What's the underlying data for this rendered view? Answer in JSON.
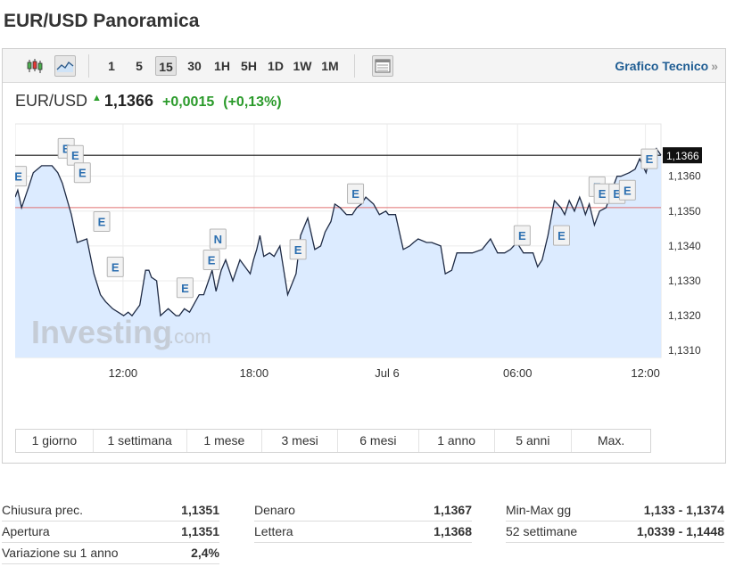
{
  "page": {
    "title": "EUR/USD Panoramica"
  },
  "toolbar": {
    "icons": [
      {
        "name": "candlestick-icon"
      },
      {
        "name": "line-chart-icon",
        "active": true
      }
    ],
    "timeframes": [
      {
        "label": "1"
      },
      {
        "label": "5"
      },
      {
        "label": "15",
        "active": true
      },
      {
        "label": "30"
      },
      {
        "label": "1H"
      },
      {
        "label": "5H"
      },
      {
        "label": "1D"
      },
      {
        "label": "1W"
      },
      {
        "label": "1M"
      }
    ],
    "technical_link": "Grafico Tecnico",
    "technical_chevron": "»"
  },
  "quote": {
    "symbol": "EUR/USD",
    "direction_icon": "▲",
    "last": "1,1366",
    "change": "+0,0015",
    "change_pct": "(+0,13%)",
    "up_color": "#2a9a2a"
  },
  "chart_data": {
    "type": "area",
    "y_ticks": [
      "1,1360",
      "1,1350",
      "1,1340",
      "1,1330",
      "1,1320",
      "1,1310"
    ],
    "ylim": [
      1.1308,
      1.1375
    ],
    "x_ticks": [
      "12:00",
      "18:00",
      "Jul 6",
      "06:00",
      "12:00"
    ],
    "last_price_label": "1,1366",
    "last_price": 1.1366,
    "prev_close": 1.1351,
    "grid": true,
    "line_color": "#1e2a44",
    "fill_color": "#dcebff",
    "prev_close_color": "#e07070",
    "watermark": "Investing",
    "watermark_suffix": ".com",
    "series": [
      {
        "x_index": [
          0,
          0.4,
          1,
          2.1,
          2.8,
          4.1,
          5.7,
          6.6,
          7.3,
          8.7,
          9.6,
          11.1,
          12.2,
          13.2,
          14,
          15.1,
          16.8,
          17.5,
          18.1,
          19.3,
          20.2,
          20.7,
          21.1,
          21.9,
          22.5,
          23.7,
          24.9,
          25.4,
          26.2,
          27,
          28.5,
          29.2,
          30.5,
          31.1,
          31.9,
          32.6,
          33.7,
          34.8,
          36.4,
          36.9,
          37.4,
          37.9,
          38.5,
          39.4,
          40.1,
          41,
          42.2,
          43.5,
          44.2,
          45.3,
          46.4,
          47.3,
          48,
          48.9,
          49.5,
          50.3,
          51.3,
          52.2,
          52.9,
          53.6,
          54.3,
          55.5,
          56.4,
          57.4,
          57.8,
          58.9,
          60.1,
          61.1,
          61.7,
          62.4,
          63.7,
          64.5,
          65.9,
          66.6,
          67.6,
          68.4,
          69.5,
          70.3,
          70.8,
          72.3,
          73.6,
          74.7,
          75.8,
          76.7,
          77.7,
          78.7,
          79.5,
          80.2,
          80.9,
          81.6,
          82.5,
          83.5,
          84.5,
          85.1,
          85.8,
          86.6,
          87.4,
          87.8,
          88.3,
          88.9,
          89.7,
          90.5,
          91.5,
          92.6,
          93.2,
          93.8,
          95.1,
          96,
          96.7,
          97.7,
          98.3,
          99.3,
          100
        ],
        "values": [
          1.1354,
          1.1356,
          1.1351,
          1.1357,
          1.1361,
          1.1363,
          1.1363,
          1.1361,
          1.1358,
          1.1349,
          1.1341,
          1.1342,
          1.1332,
          1.1326,
          1.1324,
          1.1322,
          1.132,
          1.1321,
          1.132,
          1.1323,
          1.1333,
          1.1333,
          1.1331,
          1.133,
          1.132,
          1.1322,
          1.132,
          1.132,
          1.1322,
          1.1321,
          1.1326,
          1.1326,
          1.1333,
          1.1327,
          1.1333,
          1.1336,
          1.133,
          1.1336,
          1.1332,
          1.1336,
          1.1339,
          1.1343,
          1.1337,
          1.1338,
          1.1337,
          1.134,
          1.1326,
          1.1332,
          1.1343,
          1.1348,
          1.1339,
          1.134,
          1.1344,
          1.1347,
          1.1352,
          1.1351,
          1.1349,
          1.1349,
          1.1351,
          1.1352,
          1.1354,
          1.1352,
          1.1349,
          1.135,
          1.1349,
          1.1349,
          1.1339,
          1.134,
          1.1341,
          1.1342,
          1.1341,
          1.1341,
          1.134,
          1.1332,
          1.1333,
          1.1338,
          1.1338,
          1.1338,
          1.1338,
          1.1339,
          1.1342,
          1.1338,
          1.1338,
          1.1339,
          1.1341,
          1.1338,
          1.1338,
          1.1338,
          1.1334,
          1.1336,
          1.1343,
          1.1353,
          1.1351,
          1.1349,
          1.1353,
          1.135,
          1.1354,
          1.1352,
          1.1349,
          1.1352,
          1.1346,
          1.135,
          1.1351,
          1.1357,
          1.136,
          1.136,
          1.1361,
          1.1362,
          1.1365,
          1.1361,
          1.1366,
          1.1368,
          1.1366
        ]
      }
    ],
    "markers": [
      {
        "letter": "E",
        "x_index": 0.5,
        "value": 1.136
      },
      {
        "letter": "E",
        "x_index": 7.9,
        "value": 1.1368
      },
      {
        "letter": "E",
        "x_index": 9.3,
        "value": 1.1366
      },
      {
        "letter": "E",
        "x_index": 10.4,
        "value": 1.1361
      },
      {
        "letter": "E",
        "x_index": 13.4,
        "value": 1.1347
      },
      {
        "letter": "E",
        "x_index": 15.5,
        "value": 1.1334
      },
      {
        "letter": "E",
        "x_index": 26.3,
        "value": 1.1328
      },
      {
        "letter": "E",
        "x_index": 30.4,
        "value": 1.1336
      },
      {
        "letter": "N",
        "x_index": 31.4,
        "value": 1.1342
      },
      {
        "letter": "E",
        "x_index": 43.8,
        "value": 1.1339
      },
      {
        "letter": "E",
        "x_index": 52.7,
        "value": 1.1355
      },
      {
        "letter": "E",
        "x_index": 78.5,
        "value": 1.1343
      },
      {
        "letter": "E",
        "x_index": 84.6,
        "value": 1.1343
      },
      {
        "letter": "E",
        "x_index": 90.1,
        "value": 1.1357
      },
      {
        "letter": "E",
        "x_index": 90.9,
        "value": 1.1355
      },
      {
        "letter": "E",
        "x_index": 93.2,
        "value": 1.1355
      },
      {
        "letter": "E",
        "x_index": 94.8,
        "value": 1.1356
      },
      {
        "letter": "E",
        "x_index": 98.2,
        "value": 1.1365
      }
    ]
  },
  "ranges": [
    {
      "label": "1 giorno"
    },
    {
      "label": "1 settimana"
    },
    {
      "label": "1 mese"
    },
    {
      "label": "3 mesi"
    },
    {
      "label": "6 mesi"
    },
    {
      "label": "1 anno"
    },
    {
      "label": "5 anni"
    },
    {
      "label": "Max."
    }
  ],
  "stats": {
    "col1": [
      {
        "label": "Chiusura prec.",
        "value": "1,1351"
      },
      {
        "label": "Apertura",
        "value": "1,1351"
      },
      {
        "label": "Variazione su 1 anno",
        "value": "2,4%"
      }
    ],
    "col2": [
      {
        "label": "Denaro",
        "value": "1,1367"
      },
      {
        "label": "Lettera",
        "value": "1,1368"
      }
    ],
    "col3": [
      {
        "label": "Min-Max gg",
        "value": "1,133 - 1,1374"
      },
      {
        "label": "52 settimane",
        "value": "1,0339 - 1,1448"
      }
    ]
  }
}
